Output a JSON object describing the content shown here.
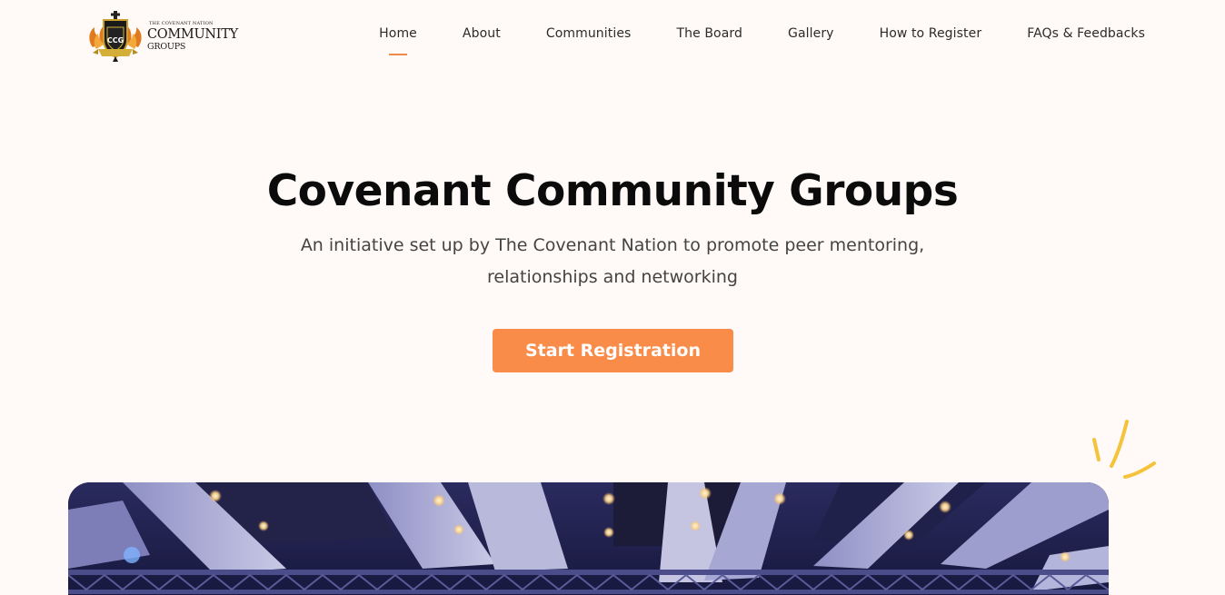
{
  "logo": {
    "small_text": "THE COVENANT NATION",
    "main_text": "COMMUNITY",
    "sub_text": "GROUPS",
    "emblem_text": "CCG"
  },
  "nav": {
    "items": [
      {
        "label": "Home",
        "active": true
      },
      {
        "label": "About"
      },
      {
        "label": "Communities"
      },
      {
        "label": "The Board"
      },
      {
        "label": "Gallery"
      },
      {
        "label": "How to Register"
      },
      {
        "label": "FAQs & Feedbacks"
      }
    ]
  },
  "hero": {
    "title": "Covenant Community Groups",
    "subtitle": "An initiative set up by The Covenant Nation to promote peer mentoring, relationships and networking",
    "cta_label": "Start Registration"
  },
  "colors": {
    "accent": "#fa8c4a",
    "background": "#fffaf7",
    "doodle": "#f5c33b",
    "hall": "#1b1c40"
  },
  "icons": [
    "ccg-emblem-icon",
    "sparkle-doodle-icon"
  ]
}
